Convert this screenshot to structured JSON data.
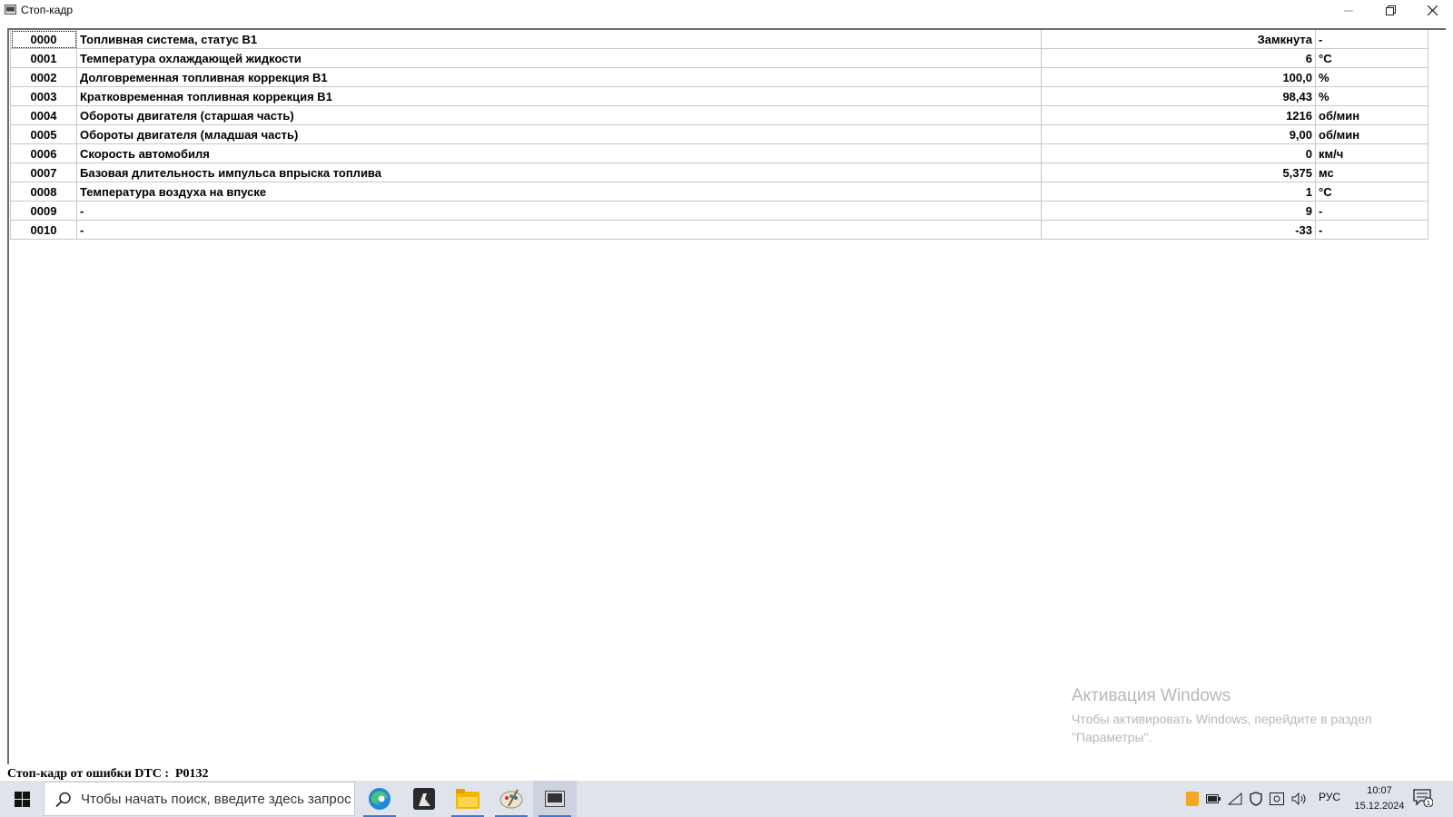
{
  "window": {
    "title": "Стоп-кадр",
    "icon": "app-window-icon",
    "controls": [
      "minimize-icon",
      "restore-icon",
      "close-icon"
    ]
  },
  "table": {
    "rows": [
      {
        "id": "0000",
        "name": "Топливная система, статус B1",
        "value": "Замкнута",
        "unit": "-"
      },
      {
        "id": "0001",
        "name": "Температура охлаждающей жидкости",
        "value": "6",
        "unit": "°C"
      },
      {
        "id": "0002",
        "name": "Долговременная топливная коррекция B1",
        "value": "100,0",
        "unit": "%"
      },
      {
        "id": "0003",
        "name": "Кратковременная топливная коррекция B1",
        "value": "98,43",
        "unit": "%"
      },
      {
        "id": "0004",
        "name": "Обороты двигателя (старшая часть)",
        "value": "1216",
        "unit": "об/мин"
      },
      {
        "id": "0005",
        "name": "Обороты двигателя (младшая часть)",
        "value": "9,00",
        "unit": "об/мин"
      },
      {
        "id": "0006",
        "name": "Скорость автомобиля",
        "value": "0",
        "unit": "км/ч"
      },
      {
        "id": "0007",
        "name": "Базовая длительность импульса впрыска топлива",
        "value": "5,375",
        "unit": "мс"
      },
      {
        "id": "0008",
        "name": "Температура воздуха на впуске",
        "value": "1",
        "unit": "°C"
      },
      {
        "id": "0009",
        "name": "-",
        "value": "9",
        "unit": "-"
      },
      {
        "id": "0010",
        "name": "-",
        "value": "-33",
        "unit": "-"
      }
    ]
  },
  "watermark": {
    "title": "Активация Windows",
    "subtitle": "Чтобы активировать Windows, перейдите в раздел \"Параметры\"."
  },
  "status": {
    "text": "Стоп-кадр от ошибки DTC :  P0132"
  },
  "taskbar": {
    "search_placeholder": "Чтобы начать поиск, введите здесь запрос",
    "language": "РУС",
    "time": "10:07",
    "date": "15.12.2024",
    "notification_count": "1"
  },
  "colors": {
    "grid_line": "#c8c8c8",
    "taskbar_bg": "#dfe3eb",
    "watermark": "#b8b8b8",
    "accent": "#3b7ad9"
  }
}
